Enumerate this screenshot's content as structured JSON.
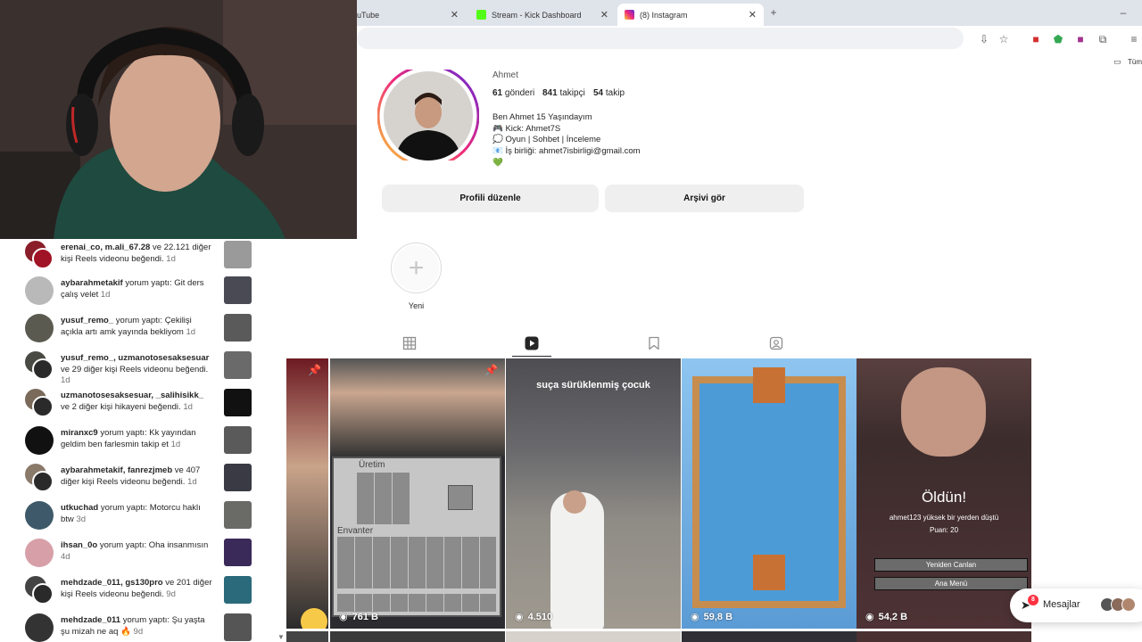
{
  "browser": {
    "tabs": [
      {
        "title": "uTube",
        "favicon": "youtube-icon"
      },
      {
        "title": "Stream - Kick Dashboard",
        "favicon": "kick-icon"
      },
      {
        "title": "(8) Instagram",
        "favicon": "instagram-icon"
      }
    ],
    "new_tab": "+",
    "minimize": "–",
    "bookmarks_folder": "Tüm"
  },
  "notifications": [
    {
      "users": "erenai_co, m.ali_67.28",
      "text": " ve 22.121 diğer kişi Reels videonu beğendi.",
      "time": "1d"
    },
    {
      "users": "aybarahmetakif",
      "text": " yorum yaptı: Git ders çalış velet",
      "time": "1d"
    },
    {
      "users": "yusuf_remo_",
      "text": " yorum yaptı: Çekilişi açıkla artı amk yayında bekliyom",
      "time": "1d"
    },
    {
      "users": "yusuf_remo_, uzmanotosesaksesuar",
      "text": " ve 29 diğer kişi Reels videonu beğendi.",
      "time": "1d"
    },
    {
      "users": "uzmanotosesaksesuar, _salihisikk_",
      "text": " ve 2 diğer kişi hikayeni beğendi.",
      "time": "1d"
    },
    {
      "users": "miranxc9",
      "text": " yorum yaptı: Kk yayından geldim ben farlesmin takip et",
      "time": "1d"
    },
    {
      "users": "aybarahmetakif, fanrezjmeb",
      "text": " ve 407 diğer kişi Reels videonu beğendi.",
      "time": "1d"
    },
    {
      "users": "utkuchad",
      "text": " yorum yaptı: Motorcu haklı btw",
      "time": "3d"
    },
    {
      "users": "ihsan_0o",
      "text": " yorum yaptı: Oha insanmısın",
      "time": "4d"
    },
    {
      "users": "mehdzade_011, gs130pro",
      "text": " ve 201 diğer kişi Reels videonu beğendi.",
      "time": "9d"
    },
    {
      "users": "mehdzade_011",
      "text": " yorum yaptı: Şu yaşta şu mizah ne aq 🔥",
      "time": "9d"
    }
  ],
  "profile": {
    "name": "Ahmet",
    "posts_count": "61",
    "posts_label": "gönderi",
    "followers_count": "841",
    "followers_label": "takipçi",
    "following_count": "54",
    "following_label": "takip",
    "bio": [
      "Ben Ahmet 15 Yaşındayım",
      "🎮 Kick: Ahmet7S",
      "💭 Oyun | Sohbet | İnceleme",
      "📧 İş birliği: ahmet7isbirligi@gmail.com",
      "💚"
    ],
    "edit_button": "Profili düzenle",
    "archive_button": "Arşivi gör",
    "highlight_new": "Yeni",
    "highlight_plus": "+"
  },
  "reels": [
    {
      "views": "",
      "pinned": true
    },
    {
      "views": "761 B",
      "pinned": true,
      "overlay": "Üretim",
      "overlay2": "Envanter"
    },
    {
      "views": "4.510",
      "pinned": false,
      "caption": "suça sürüklenmiş çocuk"
    },
    {
      "views": "59,8 B",
      "pinned": false
    },
    {
      "views": "54,2 B",
      "pinned": false,
      "game_title": "Öldün!",
      "game_sub": "ahmet123 yüksek bir yerden düştü",
      "game_score": "Puan: 20",
      "game_btn1": "Yeniden Canlan",
      "game_btn2": "Ana Menü"
    }
  ],
  "messages": {
    "label": "Mesajlar",
    "badge": "8"
  },
  "colors": {
    "link": "#00376b",
    "accent": "#0095f6",
    "badge": "#ff3040"
  }
}
